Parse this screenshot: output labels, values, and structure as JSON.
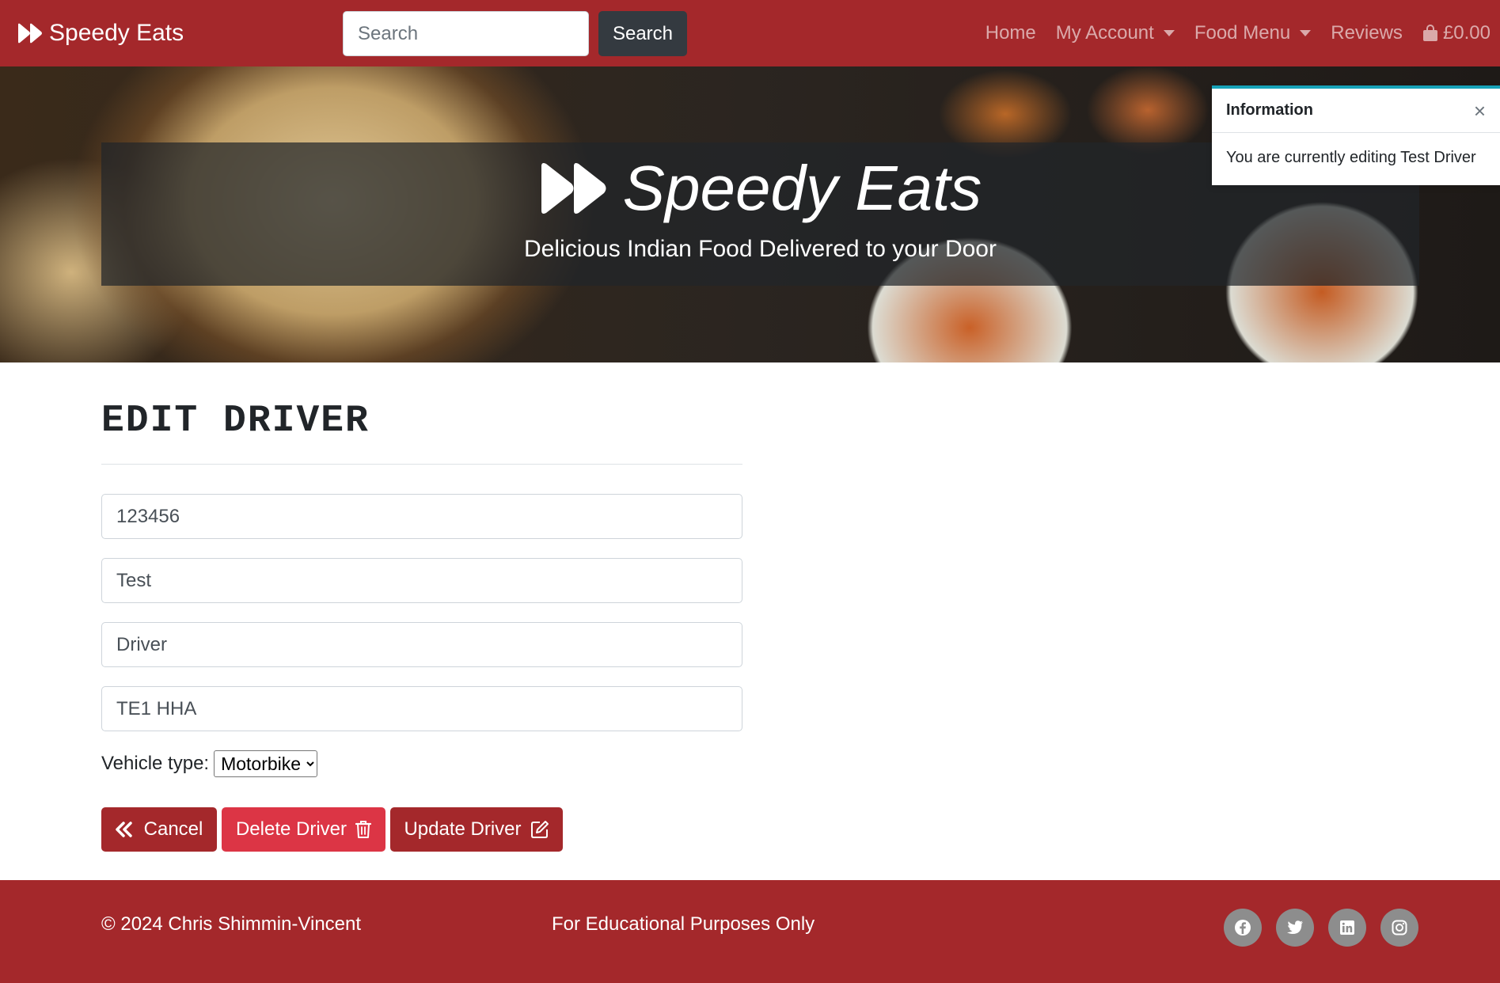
{
  "navbar": {
    "brand": "Speedy Eats",
    "brand_icon": "fast-forward-icon",
    "search_placeholder": "Search",
    "search_button": "Search",
    "links": {
      "home": "Home",
      "account": "My Account",
      "menu": "Food Menu",
      "reviews": "Reviews",
      "cart_total": "£0.00"
    }
  },
  "hero": {
    "title": "Speedy Eats",
    "subtitle": "Delicious Indian Food Delivered to your Door"
  },
  "toast": {
    "title": "Information",
    "close": "×",
    "message": "You are currently editing Test Driver"
  },
  "form": {
    "title": "EDIT DRIVER",
    "id_value": "123456",
    "first_name": "Test",
    "last_name": "Driver",
    "postcode": "TE1 HHA",
    "vehicle_label": "Vehicle type:",
    "vehicle_selected": "Motorbike",
    "buttons": {
      "cancel": "Cancel",
      "delete": "Delete Driver",
      "update": "Update Driver"
    }
  },
  "footer": {
    "copyright": "© 2024 Chris Shimmin-Vincent",
    "note": "For Educational Purposes Only",
    "socials": [
      "facebook-icon",
      "twitter-icon",
      "linkedin-icon",
      "instagram-icon"
    ]
  },
  "colors": {
    "brand": "#a4282b",
    "danger": "#dc3545",
    "dark": "#343a40",
    "toast_accent": "#17a2b8"
  }
}
